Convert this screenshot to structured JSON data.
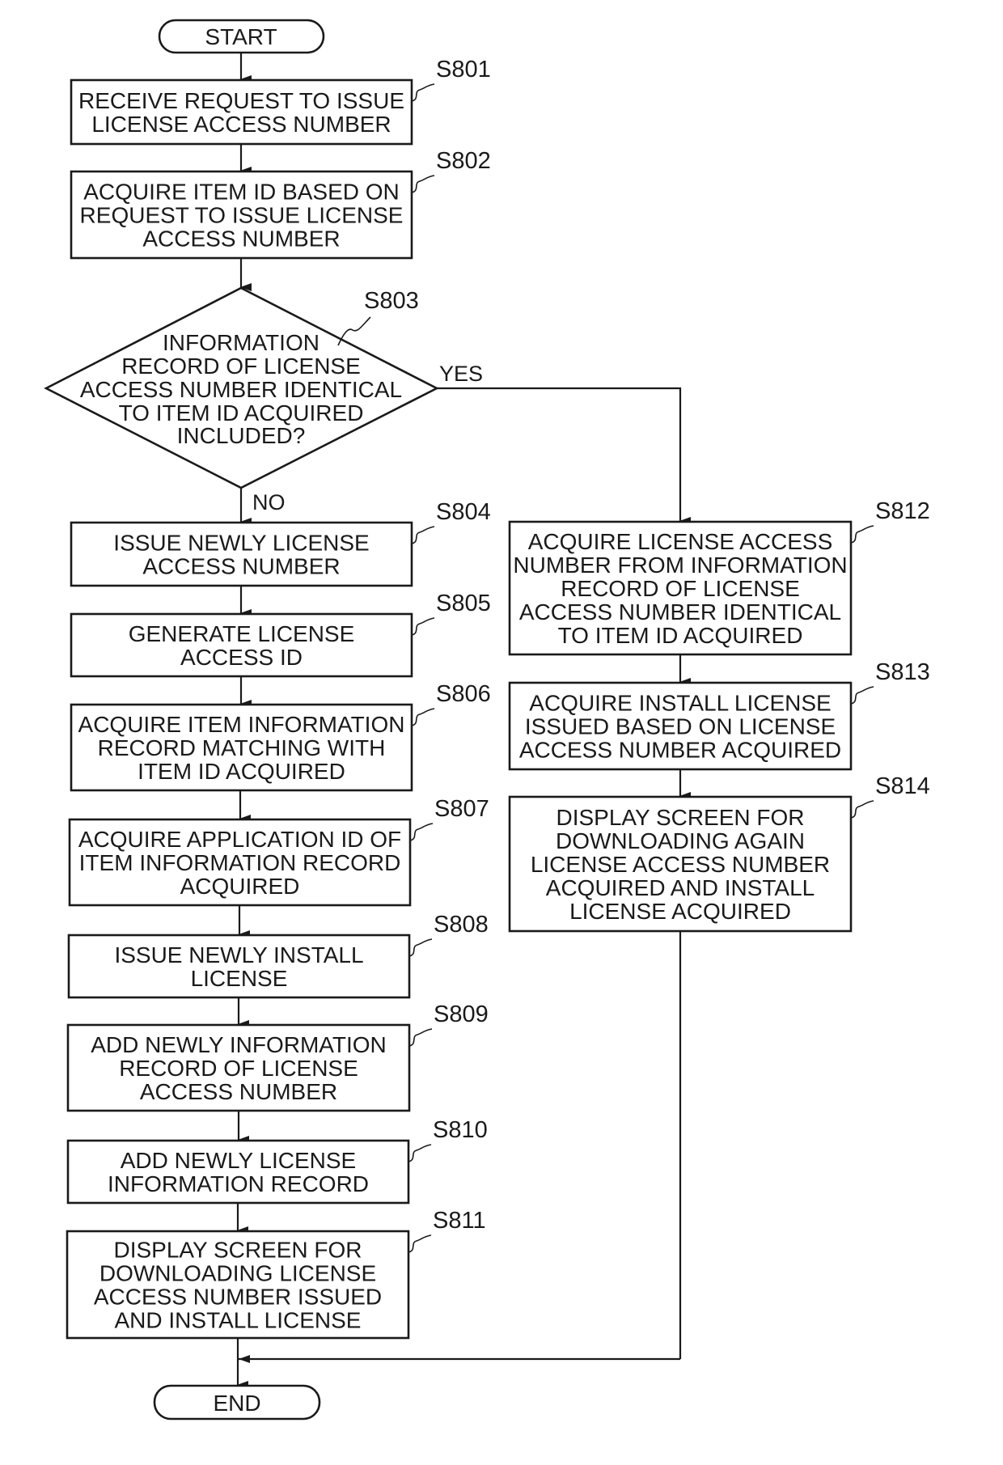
{
  "flowchart": {
    "terminals": {
      "start": "START",
      "end": "END"
    },
    "decision": {
      "id": "S803",
      "lines": [
        "INFORMATION",
        "RECORD OF LICENSE",
        "ACCESS NUMBER IDENTICAL",
        "TO ITEM ID ACQUIRED",
        "INCLUDED?"
      ],
      "yes_label": "YES",
      "no_label": "NO"
    },
    "steps": [
      {
        "id": "S801",
        "lines": [
          "RECEIVE REQUEST TO ISSUE",
          "LICENSE ACCESS NUMBER"
        ]
      },
      {
        "id": "S802",
        "lines": [
          "ACQUIRE ITEM ID BASED ON",
          "REQUEST TO ISSUE LICENSE",
          "ACCESS NUMBER"
        ]
      },
      {
        "id": "S804",
        "lines": [
          "ISSUE NEWLY LICENSE",
          "ACCESS NUMBER"
        ]
      },
      {
        "id": "S805",
        "lines": [
          "GENERATE LICENSE",
          "ACCESS ID"
        ]
      },
      {
        "id": "S806",
        "lines": [
          "ACQUIRE ITEM INFORMATION",
          "RECORD MATCHING WITH",
          "ITEM ID ACQUIRED"
        ]
      },
      {
        "id": "S807",
        "lines": [
          "ACQUIRE APPLICATION ID OF",
          "ITEM INFORMATION RECORD",
          "ACQUIRED"
        ]
      },
      {
        "id": "S808",
        "lines": [
          "ISSUE NEWLY INSTALL",
          "LICENSE"
        ]
      },
      {
        "id": "S809",
        "lines": [
          "ADD NEWLY INFORMATION",
          "RECORD OF LICENSE",
          "ACCESS NUMBER"
        ]
      },
      {
        "id": "S810",
        "lines": [
          "ADD NEWLY LICENSE",
          "INFORMATION RECORD"
        ]
      },
      {
        "id": "S811",
        "lines": [
          "DISPLAY SCREEN FOR",
          "DOWNLOADING LICENSE",
          "ACCESS NUMBER ISSUED",
          "AND INSTALL LICENSE"
        ]
      },
      {
        "id": "S812",
        "lines": [
          "ACQUIRE LICENSE ACCESS",
          "NUMBER FROM INFORMATION",
          "RECORD OF LICENSE",
          "ACCESS NUMBER IDENTICAL",
          "TO ITEM ID ACQUIRED"
        ]
      },
      {
        "id": "S813",
        "lines": [
          "ACQUIRE INSTALL LICENSE",
          "ISSUED BASED ON LICENSE",
          "ACCESS NUMBER ACQUIRED"
        ]
      },
      {
        "id": "S814",
        "lines": [
          "DISPLAY SCREEN FOR",
          "DOWNLOADING AGAIN",
          "LICENSE ACCESS NUMBER",
          "ACQUIRED AND INSTALL",
          "LICENSE ACQUIRED"
        ]
      }
    ]
  }
}
